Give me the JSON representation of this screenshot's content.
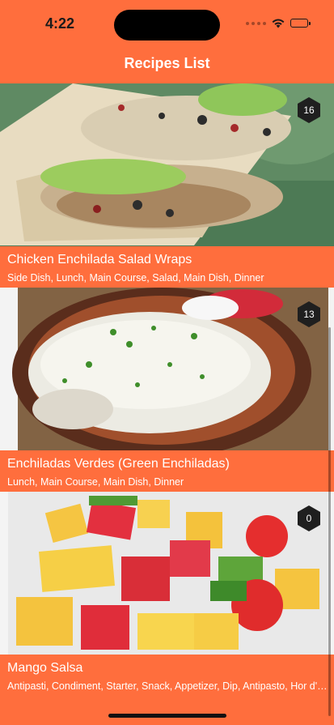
{
  "status_bar": {
    "time": "4:22"
  },
  "nav": {
    "title": "Recipes List"
  },
  "colors": {
    "accent": "#ff6e3d",
    "badge": "#1f1f1f",
    "caption_text": "#ffffff"
  },
  "recipes": [
    {
      "title": "Chicken Enchilada Salad Wraps",
      "tags": "Side Dish, Lunch, Main Course, Salad, Main Dish, Dinner",
      "count": "16",
      "image_icon": "wrap-photo"
    },
    {
      "title": "Enchiladas Verdes (Green Enchiladas)",
      "tags": "Lunch, Main Course, Main Dish, Dinner",
      "count": "13",
      "image_icon": "enchiladas-photo"
    },
    {
      "title": "Mango Salsa",
      "tags": "Antipasti, Condiment, Starter, Snack, Appetizer, Dip, Antipasto, Hor d'oeuvre, Spread",
      "count": "0",
      "image_icon": "mango-salsa-photo"
    }
  ]
}
